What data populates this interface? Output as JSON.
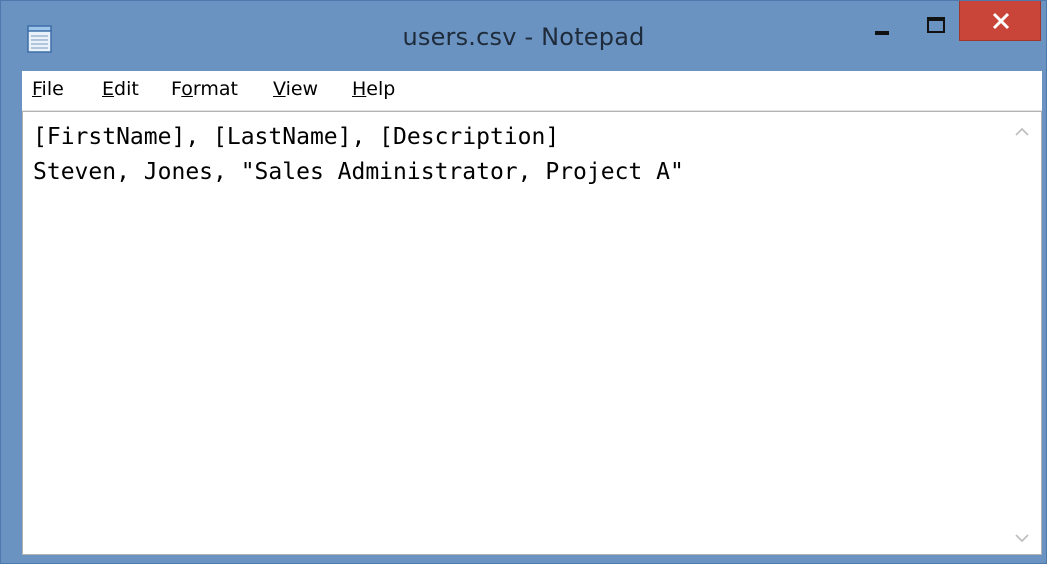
{
  "window": {
    "title": "users.csv - Notepad",
    "close_color": "#c9453a",
    "frame_color": "#6b93c2"
  },
  "menu": {
    "items": [
      {
        "pre": "",
        "acc": "F",
        "post": "ile"
      },
      {
        "pre": "",
        "acc": "E",
        "post": "dit"
      },
      {
        "pre": "F",
        "acc": "o",
        "post": "rmat"
      },
      {
        "pre": "",
        "acc": "V",
        "post": "iew"
      },
      {
        "pre": "",
        "acc": "H",
        "post": "elp"
      }
    ]
  },
  "editor": {
    "lines": [
      "[FirstName], [LastName], [Description]",
      "Steven, Jones, \"Sales Administrator, Project A\""
    ]
  },
  "icons": {
    "app": "notepad-icon",
    "minimize": "minimize-icon",
    "maximize": "maximize-icon",
    "close": "close-icon",
    "scroll_up": "chevron-up-icon",
    "scroll_down": "chevron-down-icon"
  }
}
